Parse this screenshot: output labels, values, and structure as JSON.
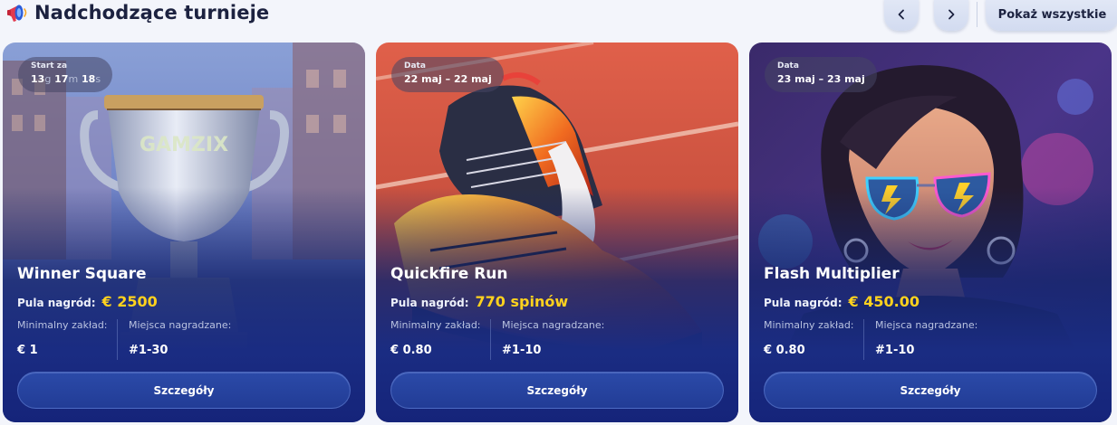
{
  "header": {
    "title": "Nadchodzące turnieje",
    "icon": "megaphone-icon",
    "prev_icon": "chevron-left-icon",
    "next_icon": "chevron-right-icon",
    "show_all_label": "Pokaż wszystkie"
  },
  "colors": {
    "prize_accent": "#ffd21e",
    "card_bottom": "#1a2c82",
    "button": "#2b4aa8"
  },
  "labels": {
    "prize_pool": "Pula nagród:",
    "min_bet": "Minimalny zakład:",
    "places": "Miejsca nagradzane:",
    "details": "Szczegóły"
  },
  "tournaments": [
    {
      "name": "Winner Square",
      "badge_label": "Start za",
      "countdown": {
        "d": "13",
        "d_unit": "g",
        "h": "17",
        "h_unit": "m",
        "s": "18",
        "s_unit": "s"
      },
      "prize": "€ 2500",
      "min_bet": "€ 1",
      "places": "#1-30",
      "art": "trophy-image"
    },
    {
      "name": "Quickfire Run",
      "badge_label": "Data",
      "badge_value": "22 maj – 22 maj",
      "prize": "770 spinów",
      "min_bet": "€ 0.80",
      "places": "#1-10",
      "art": "sneaker-image"
    },
    {
      "name": "Flash Multiplier",
      "badge_label": "Data",
      "badge_value": "23 maj – 23 maj",
      "prize": "€ 450.00",
      "min_bet": "€ 0.80",
      "places": "#1-10",
      "art": "girl-sunglasses-image"
    }
  ]
}
